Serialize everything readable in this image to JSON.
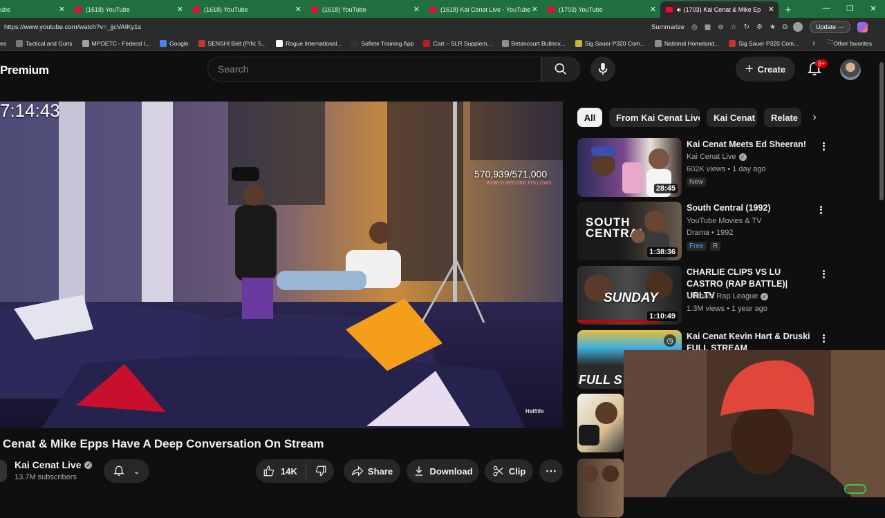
{
  "browser": {
    "tabs": [
      {
        "title": "ube",
        "first": true
      },
      {
        "title": "(1618) YouTube"
      },
      {
        "title": "(1618) YouTube"
      },
      {
        "title": "(1618) YouTube"
      },
      {
        "title": "(1618) Kai Cenat Live - YouTube"
      },
      {
        "title": "(1703) YouTube"
      },
      {
        "title": "(1703) Kai Cenat & Mike Ep",
        "active": true
      }
    ],
    "url": "https://www.youtube.com/watch?v=_jjcVAlKy1s",
    "summarize_label": "Summarize",
    "update_label": "Update",
    "bookmarks": [
      {
        "label": "es",
        "color": "#3b82c4"
      },
      {
        "label": "Tactical and Guns",
        "color": "#777777"
      },
      {
        "label": "MPOETC - Federal I...",
        "color": "#9aa0a6"
      },
      {
        "label": "Google",
        "color": "#4285f4"
      },
      {
        "label": "SENSHI Belt (P/N: 5...",
        "color": "#c0392b"
      },
      {
        "label": "Rogue International...",
        "color": "#ffffff"
      },
      {
        "label": "Soflete Training App",
        "color": "#333333"
      },
      {
        "label": "Cart – SLR Supplem...",
        "color": "#b71c1c"
      },
      {
        "label": "Betancourt Bullnox...",
        "color": "#8e8e8e"
      },
      {
        "label": "Sig Sauer P320 Com...",
        "color": "#c9b037"
      },
      {
        "label": "National Homeland...",
        "color": "#8e8e8e"
      },
      {
        "label": "Sig Sauer P320 Com...",
        "color": "#c0392b"
      }
    ],
    "other_favorites": "Other favorites"
  },
  "header": {
    "logo": "Premium",
    "search_placeholder": "Search",
    "create_label": "Create",
    "notification_count": "9+"
  },
  "video": {
    "timer": "7:14:43",
    "counter": "570,939/571,000",
    "counter_sub": "WORLD RECORD FOLLOWS",
    "watermark": "Halflife",
    "title": "Cenat & Mike Epps Have A Deep Conversation On Stream",
    "channel": "Kai Cenat Live",
    "subscribers": "13.7M subscribers",
    "likes": "14K",
    "share_label": "Share",
    "download_label": "Download",
    "clip_label": "Clip"
  },
  "chips": [
    {
      "label": "All",
      "selected": true
    },
    {
      "label": "From Kai Cenat Live"
    },
    {
      "label": "Kai Cenat"
    },
    {
      "label": "Relate"
    }
  ],
  "recommendations": [
    {
      "title": "Kai Cenat Meets Ed Sheeran!",
      "channel": "Kai Cenat Live",
      "verified": true,
      "meta": "602K views • 1 day ago",
      "tag": "New",
      "duration": "28:45"
    },
    {
      "title": "South Central (1992)",
      "channel": "YouTube Movies & TV",
      "verified": false,
      "meta": "Drama • 1992",
      "tag": "Free",
      "tag2": "R",
      "duration": "1:38:36",
      "thumb_text": "SOUTH CENTRAL"
    },
    {
      "title": "CHARLIE CLIPS VS LU CASTRO (RAP BATTLE)| URLTV",
      "channel": "Ultimate Rap League",
      "verified": true,
      "meta": "1.3M views • 1 year ago",
      "duration": "1:10:49",
      "thumb_text": "SUNDAY"
    },
    {
      "title": "Kai Cenat Kevin Hart & Druski FULL STREAM",
      "channel": "",
      "verified": false,
      "meta": "",
      "duration": "",
      "thumb_text": "FULL S"
    }
  ]
}
